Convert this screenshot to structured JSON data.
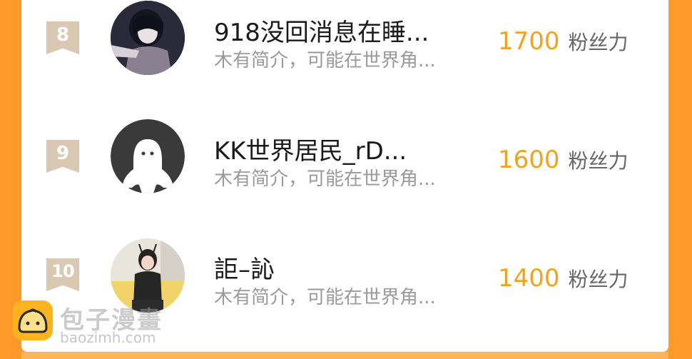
{
  "ranking": [
    {
      "rank": "8",
      "name": "918没回消息在睡...",
      "intro": "木有简介，可能在世界角...",
      "fans": "1700",
      "fans_unit": "粉丝力",
      "avatar_icon": "user-photo-avatar"
    },
    {
      "rank": "9",
      "name": "KK世界居民_rD...",
      "intro": "木有简介，可能在世界角...",
      "fans": "1600",
      "fans_unit": "粉丝力",
      "avatar_icon": "default-ghost-avatar"
    },
    {
      "rank": "10",
      "name": "詎–訫",
      "intro": "木有简介，可能在世界角...",
      "fans": "1400",
      "fans_unit": "粉丝力",
      "avatar_icon": "user-photo-avatar"
    }
  ],
  "watermark": {
    "title": "包子漫畫",
    "url": "baozimh.com",
    "logo_icon": "bun-logo-icon"
  },
  "colors": {
    "background": "#ff9a2a",
    "fans_number": "#f0a31e",
    "rank_badge": "#d9c9b3"
  }
}
